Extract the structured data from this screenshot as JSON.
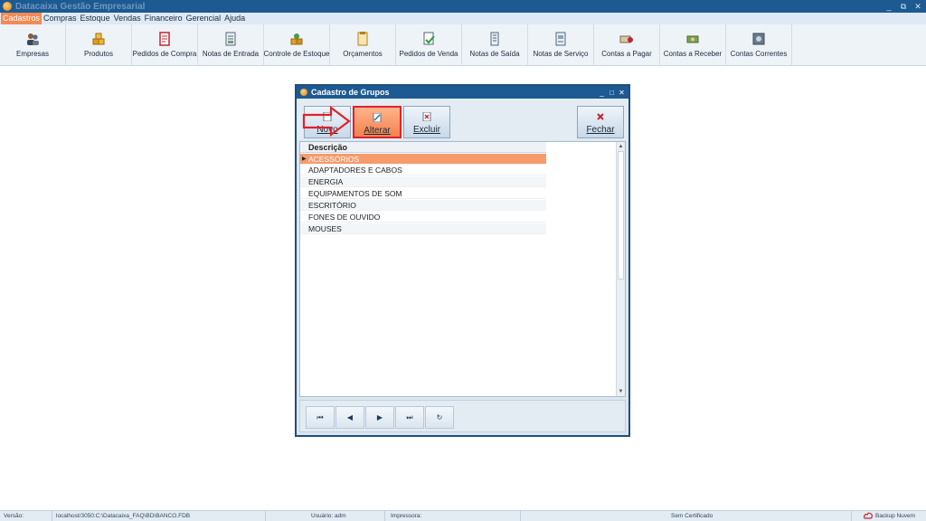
{
  "window": {
    "title": "Datacaixa Gestão Empresarial",
    "controls": [
      "_",
      "⧉",
      "✕"
    ]
  },
  "menu": {
    "items": [
      "Cadastros",
      "Compras",
      "Estoque",
      "Vendas",
      "Financeiro",
      "Gerencial",
      "Ajuda"
    ],
    "active": "Cadastros"
  },
  "toolbar": {
    "buttons": [
      {
        "label": "Empresas",
        "icon": "people-icon"
      },
      {
        "label": "Produtos",
        "icon": "boxes-icon"
      },
      {
        "label": "Pedidos de Compra",
        "icon": "purchase-order-icon"
      },
      {
        "label": "Notas de Entrada",
        "icon": "entry-note-icon"
      },
      {
        "label": "Controle de Estoque",
        "icon": "stock-control-icon"
      },
      {
        "label": "Orçamentos",
        "icon": "budget-icon"
      },
      {
        "label": "Pedidos de Venda",
        "icon": "sales-order-icon"
      },
      {
        "label": "Notas de Saída",
        "icon": "exit-note-icon"
      },
      {
        "label": "Notas de Serviço",
        "icon": "service-note-icon"
      },
      {
        "label": "Contas a Pagar",
        "icon": "payables-icon"
      },
      {
        "label": "Contas a Receber",
        "icon": "receivables-icon"
      },
      {
        "label": "Contas Correntes",
        "icon": "safe-icon"
      }
    ]
  },
  "dialog": {
    "title": "Cadastro de Grupos",
    "controls": [
      "_",
      "□",
      "✕"
    ],
    "buttons": {
      "novo": "Novo",
      "alterar": "Alterar",
      "excluir": "Excluir",
      "fechar": "Fechar"
    },
    "grid": {
      "column": "Descrição",
      "rows": [
        "ACESSÓRIOS",
        "ADAPTADORES E CABOS",
        "ENERGIA",
        "EQUIPAMENTOS DE SOM",
        "ESCRITÓRIO",
        "FONES DE OUVIDO",
        "MOUSES"
      ],
      "selected_index": 0
    },
    "nav": {
      "first": "⏮",
      "prior": "◀",
      "next": "▶",
      "last": "⏭",
      "refresh": "↻"
    }
  },
  "status": {
    "version": "Versão: 2022.05.23",
    "database": "localhost/3050:C:\\Datacaixa_FAQ\\BD\\BANCO.FDB",
    "user": "Usuário: adm",
    "printer": "Impressora:",
    "certificate": "Sem Certificado",
    "backup": "Backup Nuvem"
  },
  "colors": {
    "titlebar": "#1d5a92",
    "accent": "#f28a54",
    "selected_row": "#f59b6c",
    "highlight_border": "#e0222e"
  }
}
